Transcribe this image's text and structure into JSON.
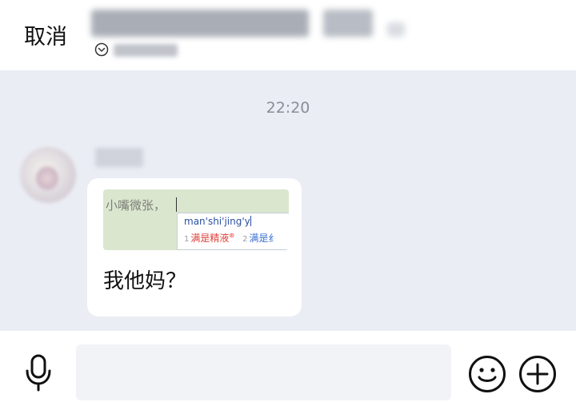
{
  "header": {
    "cancel_label": "取消"
  },
  "chat": {
    "timestamp": "22:20",
    "messages": [
      {
        "screenshot": {
          "typed_text": "小嘴微张，",
          "ime_pinyin": "man'shi'jing'y",
          "candidates": [
            {
              "index": "1",
              "text": "满是精液"
            },
            {
              "index": "2",
              "text": "满是纟"
            }
          ]
        },
        "text": "我他妈？"
      }
    ]
  },
  "input_bar": {
    "placeholder": "",
    "icons": {
      "voice": "microphone-icon",
      "emoji": "smiley-icon",
      "more": "plus-circle-icon"
    }
  }
}
